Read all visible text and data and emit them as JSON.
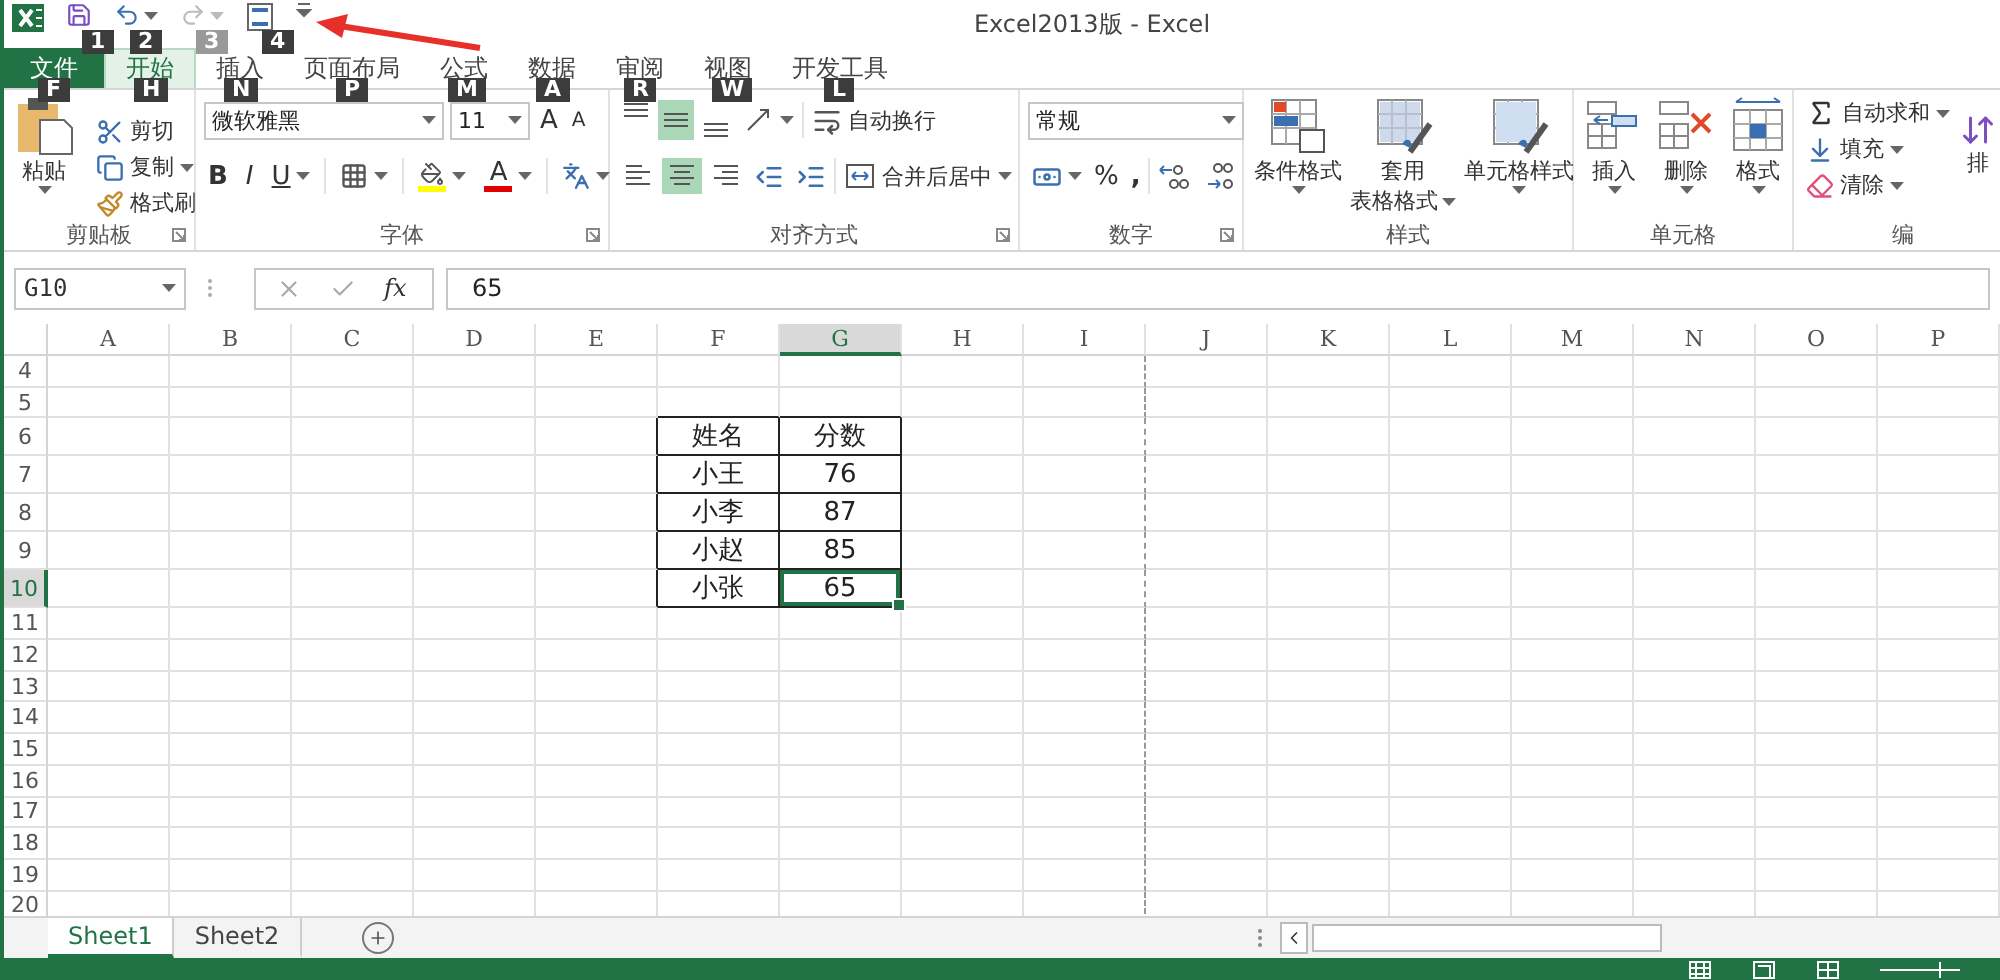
{
  "window": {
    "title": "Excel2013版 - Excel"
  },
  "quick_access": [
    {
      "kind": "logo"
    },
    {
      "kind": "save",
      "keytip": "1",
      "disabled": false
    },
    {
      "kind": "undo",
      "keytip": "2",
      "disabled": false
    },
    {
      "kind": "redo",
      "keytip": "3",
      "disabled": true
    },
    {
      "kind": "preview",
      "keytip": "4",
      "disabled": false
    },
    {
      "kind": "customize"
    }
  ],
  "tabs": [
    {
      "label": "文件",
      "kind": "file",
      "keytip": "F",
      "selected": false
    },
    {
      "label": "开始",
      "kind": "tab",
      "keytip": "H",
      "selected": true
    },
    {
      "label": "插入",
      "kind": "tab",
      "keytip": "N",
      "selected": false
    },
    {
      "label": "页面布局",
      "kind": "tab",
      "keytip": "P",
      "selected": false
    },
    {
      "label": "公式",
      "kind": "tab",
      "keytip": "M",
      "selected": false
    },
    {
      "label": "数据",
      "kind": "tab",
      "keytip": "A",
      "selected": false
    },
    {
      "label": "审阅",
      "kind": "tab",
      "keytip": "R",
      "selected": false
    },
    {
      "label": "视图",
      "kind": "tab",
      "keytip": "W",
      "selected": false
    },
    {
      "label": "开发工具",
      "kind": "tab",
      "keytip": "L",
      "selected": false
    }
  ],
  "ribbon": {
    "groups": [
      {
        "kind": "clipboard",
        "label": "剪贴板",
        "paste": "粘贴",
        "cut": "剪切",
        "copy": "复制",
        "format_painter": "格式刷"
      },
      {
        "kind": "font",
        "label": "字体",
        "font_name": "微软雅黑",
        "font_size": "11",
        "grow": "A",
        "shrink": "A",
        "bold": "B",
        "italic": "I",
        "underline": "U",
        "font_color": "A"
      },
      {
        "kind": "alignment",
        "label": "对齐方式",
        "wrap": "自动换行",
        "merge": "合并后居中",
        "vertical": [
          {
            "kind": "top",
            "selected": false
          },
          {
            "kind": "middle",
            "selected": true
          },
          {
            "kind": "bottom",
            "selected": false
          }
        ],
        "horizontal": [
          {
            "kind": "left",
            "selected": false
          },
          {
            "kind": "center",
            "selected": true
          },
          {
            "kind": "right",
            "selected": false
          }
        ]
      },
      {
        "kind": "number",
        "label": "数字",
        "format": "常规",
        "percent": "%",
        "comma": ","
      },
      {
        "kind": "styles",
        "label": "样式",
        "buttons": [
          {
            "kind": "conditional",
            "lines": [
              "条件格式"
            ]
          },
          {
            "kind": "table",
            "lines": [
              "套用",
              "表格格式"
            ]
          },
          {
            "kind": "cell",
            "lines": [
              "单元格样式"
            ]
          }
        ]
      },
      {
        "kind": "cells",
        "label": "单元格",
        "buttons": [
          {
            "kind": "insert",
            "label": "插入"
          },
          {
            "kind": "delete",
            "label": "删除"
          },
          {
            "kind": "format",
            "label": "格式"
          }
        ]
      },
      {
        "kind": "editing",
        "label": "编",
        "autosum": "自动求和",
        "fill": "填充",
        "clear": "清除",
        "sort": "排"
      }
    ]
  },
  "formula_bar": {
    "name_box": "G10",
    "function_label": "fx",
    "value": "65"
  },
  "columns": [
    {
      "label": "A",
      "selected": false
    },
    {
      "label": "B",
      "selected": false
    },
    {
      "label": "C",
      "selected": false
    },
    {
      "label": "D",
      "selected": false
    },
    {
      "label": "E",
      "selected": false
    },
    {
      "label": "F",
      "selected": false
    },
    {
      "label": "G",
      "selected": true
    },
    {
      "label": "H",
      "selected": false
    },
    {
      "label": "I",
      "selected": false
    },
    {
      "label": "J",
      "selected": false
    },
    {
      "label": "K",
      "selected": false
    },
    {
      "label": "L",
      "selected": false
    },
    {
      "label": "M",
      "selected": false
    },
    {
      "label": "N",
      "selected": false
    },
    {
      "label": "O",
      "selected": false
    },
    {
      "label": "P",
      "selected": false
    }
  ],
  "rows": [
    {
      "label": "4",
      "selected": false
    },
    {
      "label": "5",
      "selected": false
    },
    {
      "label": "6",
      "selected": false
    },
    {
      "label": "7",
      "selected": false
    },
    {
      "label": "8",
      "selected": false
    },
    {
      "label": "9",
      "selected": false
    },
    {
      "label": "10",
      "selected": true
    },
    {
      "label": "11",
      "selected": false
    },
    {
      "label": "12",
      "selected": false
    },
    {
      "label": "13",
      "selected": false
    },
    {
      "label": "14",
      "selected": false
    },
    {
      "label": "15",
      "selected": false
    },
    {
      "label": "16",
      "selected": false
    },
    {
      "label": "17",
      "selected": false
    },
    {
      "label": "18",
      "selected": false
    },
    {
      "label": "19",
      "selected": false
    },
    {
      "label": "20",
      "selected": false
    }
  ],
  "table": {
    "rows": [
      [
        {
          "text": "姓名",
          "selected": false
        },
        {
          "text": "分数",
          "selected": false
        }
      ],
      [
        {
          "text": "小王",
          "selected": false
        },
        {
          "text": "76",
          "selected": false
        }
      ],
      [
        {
          "text": "小李",
          "selected": false
        },
        {
          "text": "87",
          "selected": false
        }
      ],
      [
        {
          "text": "小赵",
          "selected": false
        },
        {
          "text": "85",
          "selected": false
        }
      ],
      [
        {
          "text": "小张",
          "selected": false
        },
        {
          "text": "65",
          "selected": true
        }
      ]
    ]
  },
  "sheets": [
    {
      "label": "Sheet1",
      "selected": true
    },
    {
      "label": "Sheet2",
      "selected": false
    }
  ]
}
